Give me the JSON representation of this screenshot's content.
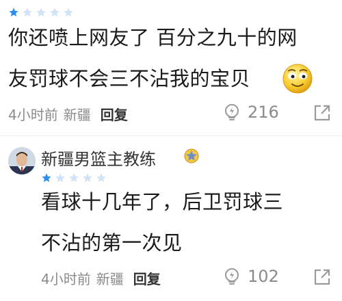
{
  "comments": [
    {
      "rating": 1,
      "text_line1": "你还喷上网友了 百分之九十的网",
      "text_line2": "友罚球不会三不沾我的宝贝",
      "emoji": "smiling-face-emoji",
      "time": "4小时前",
      "location": "新疆",
      "reply_label": "回复",
      "likes": "216"
    },
    {
      "username": "新疆男篮主教练",
      "rating": 1,
      "text_line1": "看球十几年了，后卫罚球三",
      "text_line2": "不沾的第一次见",
      "time": "4小时前",
      "location": "新疆",
      "reply_label": "回复",
      "likes": "102"
    }
  ],
  "colors": {
    "star_active": "#2f8df2",
    "star_inactive": "#cfe2f8",
    "meta_text": "#8a8a8a",
    "text": "#1a1a1a"
  },
  "icons": [
    "star-icon",
    "lightbulb-like-icon",
    "share-icon",
    "badge-icon"
  ]
}
